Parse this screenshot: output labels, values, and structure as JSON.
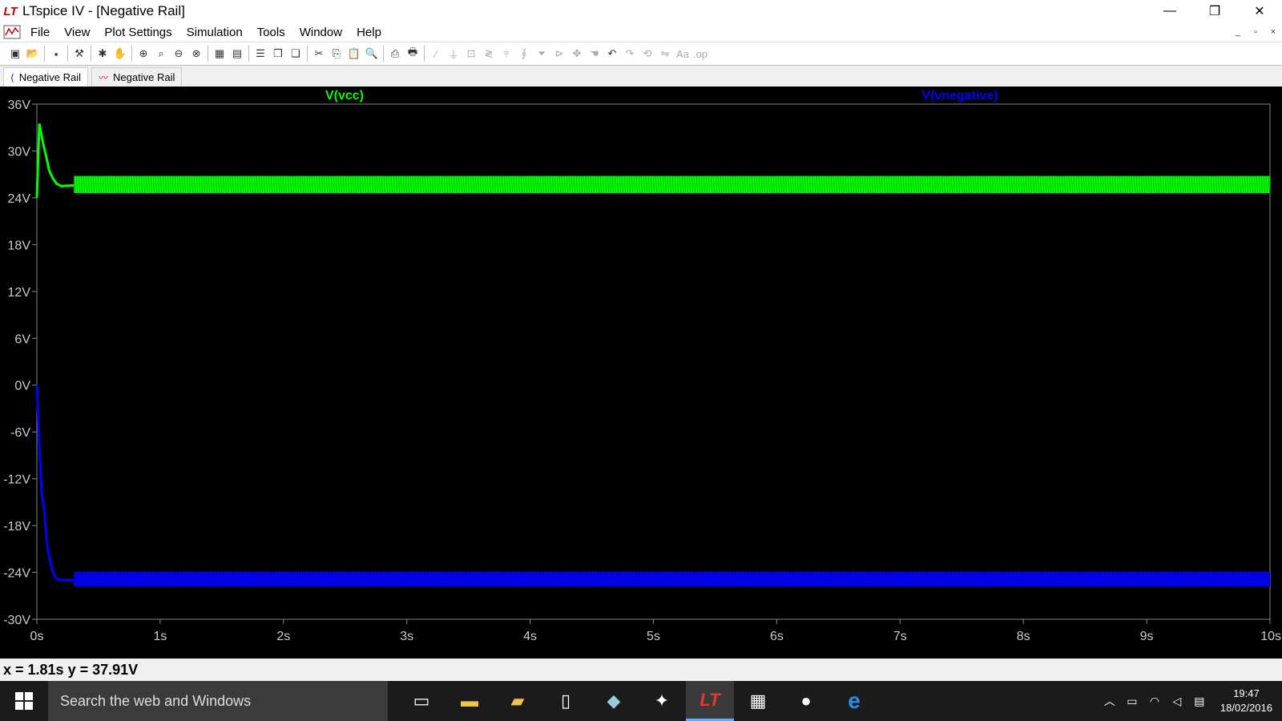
{
  "window": {
    "title": "LTspice IV - [Negative Rail]",
    "app_icon_text": "LT",
    "minimize": "—",
    "restore": "❐",
    "close": "✕"
  },
  "menu": {
    "items": [
      "File",
      "View",
      "Plot Settings",
      "Simulation",
      "Tools",
      "Window",
      "Help"
    ],
    "mdi_buttons": [
      "_",
      "▫",
      "×"
    ]
  },
  "tabs": [
    {
      "label": "Negative Rail",
      "icon": "schematic-icon"
    },
    {
      "label": "Negative Rail",
      "icon": "waveform-icon"
    }
  ],
  "chart_data": {
    "type": "line",
    "background": "#000000",
    "x_ticks": [
      "0s",
      "1s",
      "2s",
      "3s",
      "4s",
      "5s",
      "6s",
      "7s",
      "8s",
      "9s",
      "10s"
    ],
    "y_ticks": [
      "36V",
      "30V",
      "24V",
      "18V",
      "12V",
      "6V",
      "0V",
      "-6V",
      "-12V",
      "-18V",
      "-24V",
      "-30V"
    ],
    "xlim": [
      0,
      10
    ],
    "ylim": [
      -30,
      36
    ],
    "series": [
      {
        "name": "V(vcc)",
        "color": "#00ff00",
        "x": [
          0,
          0.02,
          0.05,
          0.08,
          0.1,
          0.13,
          0.16,
          0.2,
          0.3,
          10
        ],
        "y": [
          24,
          33.5,
          31,
          29,
          27.5,
          26.5,
          25.8,
          25.5,
          25.6,
          25.6
        ],
        "ripple_band": [
          24.6,
          26.8
        ]
      },
      {
        "name": "V(vnegative)",
        "color": "#0000ff",
        "x": [
          0,
          0.02,
          0.04,
          0.06,
          0.08,
          0.1,
          0.13,
          0.16,
          0.2,
          0.3,
          10
        ],
        "y": [
          0,
          -8,
          -14,
          -16,
          -20,
          -22,
          -24,
          -24.8,
          -25,
          -25,
          -25
        ],
        "ripple_band": [
          -25.8,
          -23.9
        ]
      }
    ]
  },
  "status": {
    "cursor_text": "x = 1.81s    y = 37.91V"
  },
  "taskbar": {
    "search_placeholder": "Search the web and Windows",
    "time": "19:47",
    "date": "18/02/2016"
  }
}
